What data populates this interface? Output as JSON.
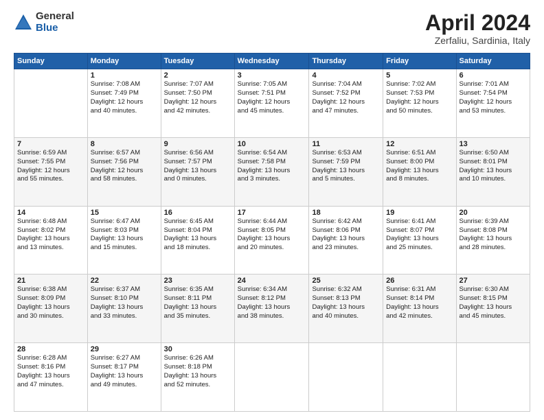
{
  "header": {
    "logo_line1": "General",
    "logo_line2": "Blue",
    "month_title": "April 2024",
    "location": "Zerfaliu, Sardinia, Italy"
  },
  "weekdays": [
    "Sunday",
    "Monday",
    "Tuesday",
    "Wednesday",
    "Thursday",
    "Friday",
    "Saturday"
  ],
  "weeks": [
    [
      {
        "day": "",
        "info": ""
      },
      {
        "day": "1",
        "info": "Sunrise: 7:08 AM\nSunset: 7:49 PM\nDaylight: 12 hours\nand 40 minutes."
      },
      {
        "day": "2",
        "info": "Sunrise: 7:07 AM\nSunset: 7:50 PM\nDaylight: 12 hours\nand 42 minutes."
      },
      {
        "day": "3",
        "info": "Sunrise: 7:05 AM\nSunset: 7:51 PM\nDaylight: 12 hours\nand 45 minutes."
      },
      {
        "day": "4",
        "info": "Sunrise: 7:04 AM\nSunset: 7:52 PM\nDaylight: 12 hours\nand 47 minutes."
      },
      {
        "day": "5",
        "info": "Sunrise: 7:02 AM\nSunset: 7:53 PM\nDaylight: 12 hours\nand 50 minutes."
      },
      {
        "day": "6",
        "info": "Sunrise: 7:01 AM\nSunset: 7:54 PM\nDaylight: 12 hours\nand 53 minutes."
      }
    ],
    [
      {
        "day": "7",
        "info": "Sunrise: 6:59 AM\nSunset: 7:55 PM\nDaylight: 12 hours\nand 55 minutes."
      },
      {
        "day": "8",
        "info": "Sunrise: 6:57 AM\nSunset: 7:56 PM\nDaylight: 12 hours\nand 58 minutes."
      },
      {
        "day": "9",
        "info": "Sunrise: 6:56 AM\nSunset: 7:57 PM\nDaylight: 13 hours\nand 0 minutes."
      },
      {
        "day": "10",
        "info": "Sunrise: 6:54 AM\nSunset: 7:58 PM\nDaylight: 13 hours\nand 3 minutes."
      },
      {
        "day": "11",
        "info": "Sunrise: 6:53 AM\nSunset: 7:59 PM\nDaylight: 13 hours\nand 5 minutes."
      },
      {
        "day": "12",
        "info": "Sunrise: 6:51 AM\nSunset: 8:00 PM\nDaylight: 13 hours\nand 8 minutes."
      },
      {
        "day": "13",
        "info": "Sunrise: 6:50 AM\nSunset: 8:01 PM\nDaylight: 13 hours\nand 10 minutes."
      }
    ],
    [
      {
        "day": "14",
        "info": "Sunrise: 6:48 AM\nSunset: 8:02 PM\nDaylight: 13 hours\nand 13 minutes."
      },
      {
        "day": "15",
        "info": "Sunrise: 6:47 AM\nSunset: 8:03 PM\nDaylight: 13 hours\nand 15 minutes."
      },
      {
        "day": "16",
        "info": "Sunrise: 6:45 AM\nSunset: 8:04 PM\nDaylight: 13 hours\nand 18 minutes."
      },
      {
        "day": "17",
        "info": "Sunrise: 6:44 AM\nSunset: 8:05 PM\nDaylight: 13 hours\nand 20 minutes."
      },
      {
        "day": "18",
        "info": "Sunrise: 6:42 AM\nSunset: 8:06 PM\nDaylight: 13 hours\nand 23 minutes."
      },
      {
        "day": "19",
        "info": "Sunrise: 6:41 AM\nSunset: 8:07 PM\nDaylight: 13 hours\nand 25 minutes."
      },
      {
        "day": "20",
        "info": "Sunrise: 6:39 AM\nSunset: 8:08 PM\nDaylight: 13 hours\nand 28 minutes."
      }
    ],
    [
      {
        "day": "21",
        "info": "Sunrise: 6:38 AM\nSunset: 8:09 PM\nDaylight: 13 hours\nand 30 minutes."
      },
      {
        "day": "22",
        "info": "Sunrise: 6:37 AM\nSunset: 8:10 PM\nDaylight: 13 hours\nand 33 minutes."
      },
      {
        "day": "23",
        "info": "Sunrise: 6:35 AM\nSunset: 8:11 PM\nDaylight: 13 hours\nand 35 minutes."
      },
      {
        "day": "24",
        "info": "Sunrise: 6:34 AM\nSunset: 8:12 PM\nDaylight: 13 hours\nand 38 minutes."
      },
      {
        "day": "25",
        "info": "Sunrise: 6:32 AM\nSunset: 8:13 PM\nDaylight: 13 hours\nand 40 minutes."
      },
      {
        "day": "26",
        "info": "Sunrise: 6:31 AM\nSunset: 8:14 PM\nDaylight: 13 hours\nand 42 minutes."
      },
      {
        "day": "27",
        "info": "Sunrise: 6:30 AM\nSunset: 8:15 PM\nDaylight: 13 hours\nand 45 minutes."
      }
    ],
    [
      {
        "day": "28",
        "info": "Sunrise: 6:28 AM\nSunset: 8:16 PM\nDaylight: 13 hours\nand 47 minutes."
      },
      {
        "day": "29",
        "info": "Sunrise: 6:27 AM\nSunset: 8:17 PM\nDaylight: 13 hours\nand 49 minutes."
      },
      {
        "day": "30",
        "info": "Sunrise: 6:26 AM\nSunset: 8:18 PM\nDaylight: 13 hours\nand 52 minutes."
      },
      {
        "day": "",
        "info": ""
      },
      {
        "day": "",
        "info": ""
      },
      {
        "day": "",
        "info": ""
      },
      {
        "day": "",
        "info": ""
      }
    ]
  ]
}
